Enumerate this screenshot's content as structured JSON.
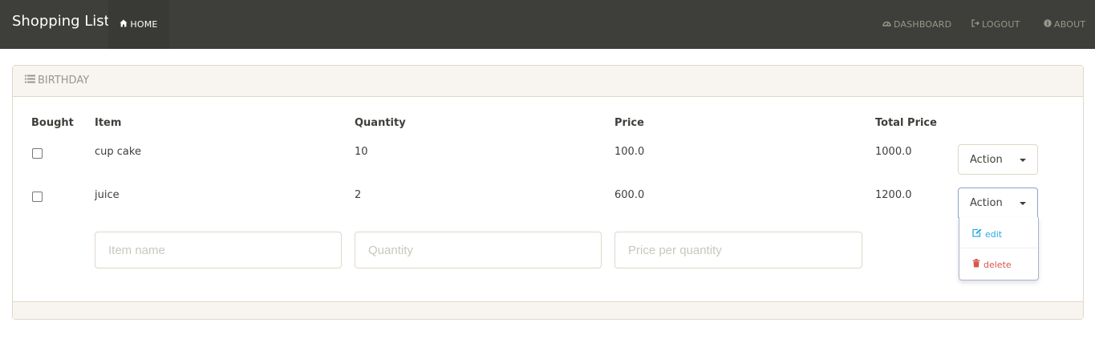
{
  "app": {
    "title": "Shopping List"
  },
  "nav": {
    "home": "HOME",
    "dashboard": "DASHBOARD",
    "logout": "LOGOUT",
    "about": "ABOUT"
  },
  "list": {
    "title": "BIRTHDAY",
    "columns": [
      "Bought",
      "Item",
      "Quantity",
      "Price",
      "Total Price"
    ],
    "rows": [
      {
        "bought": false,
        "item": "cup cake",
        "quantity": "10",
        "price": "100.0",
        "total": "1000.0",
        "action": "Action"
      },
      {
        "bought": false,
        "item": "juice",
        "quantity": "2",
        "price": "600.0",
        "total": "1200.0",
        "action": "Action"
      }
    ]
  },
  "dropdown": {
    "edit": "edit",
    "delete": "delete"
  },
  "form": {
    "item_placeholder": "Item name",
    "quantity_placeholder": "Quantity",
    "price_placeholder": "Price per quantity"
  },
  "colors": {
    "navbar": "#3e3f3a",
    "edit": "#29abe0",
    "delete": "#d9534f"
  },
  "icons": {
    "home": "home-icon",
    "dashboard": "dashboard-icon",
    "logout": "logout-icon",
    "about": "info-icon",
    "list": "list-icon",
    "edit": "edit-icon",
    "delete": "trash-icon"
  }
}
